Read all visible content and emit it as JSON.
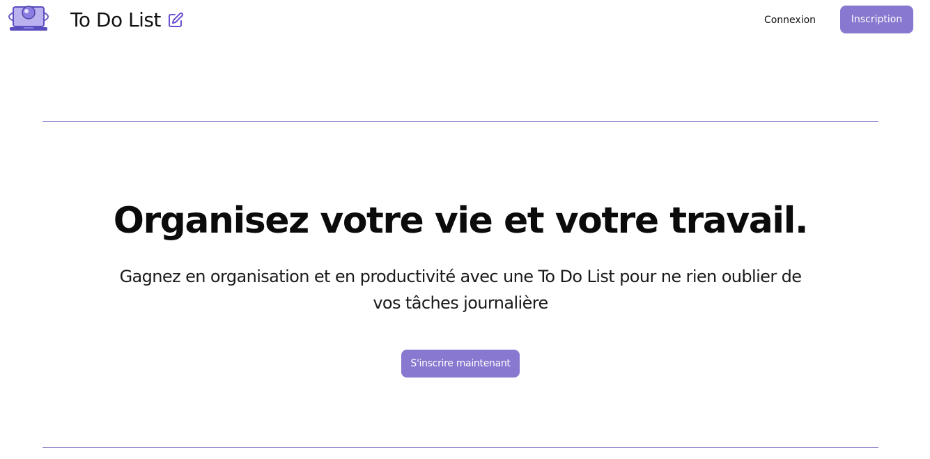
{
  "header": {
    "logo_icon": "laptop-planet-logo-icon",
    "title": "To Do List",
    "title_icon": "edit-icon",
    "nav": {
      "login_label": "Connexion",
      "signup_label": "Inscription"
    }
  },
  "hero": {
    "title": "Organisez votre vie et votre travail.",
    "subtitle": "Gagnez en organisation et en productivité avec une To Do List pour ne rien oublier de vos tâches journalière",
    "cta_label": "S'inscrire maintenant"
  },
  "colors": {
    "accent": "#8878cf",
    "divider": "#9c92d4",
    "text": "#111111",
    "background": "#ffffff"
  }
}
